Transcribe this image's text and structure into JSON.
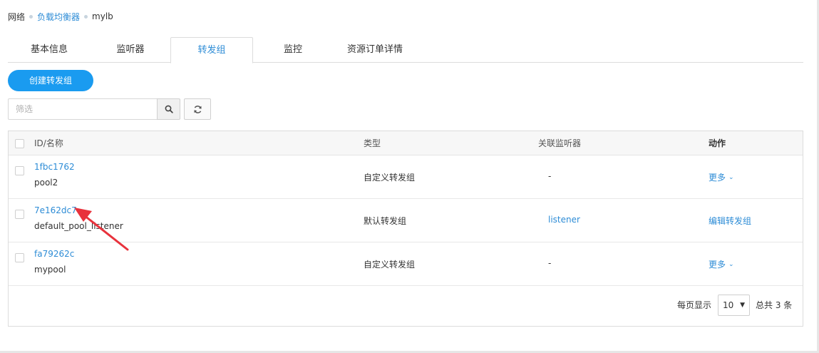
{
  "breadcrumb": {
    "items": [
      {
        "label": "网络"
      },
      {
        "label": "负载均衡器"
      },
      {
        "label": "mylb"
      }
    ]
  },
  "tabs": [
    {
      "label": "基本信息"
    },
    {
      "label": "监听器"
    },
    {
      "label": "转发组",
      "active": true
    },
    {
      "label": "监控"
    },
    {
      "label": "资源订单详情"
    }
  ],
  "toolbar": {
    "create_label": "创建转发组",
    "filter_placeholder": "筛选"
  },
  "table": {
    "columns": {
      "id_name": "ID/名称",
      "type": "类型",
      "listener": "关联监听器",
      "action": "动作"
    },
    "rows": [
      {
        "id": "1fbc1762",
        "name": "pool2",
        "type": "自定义转发组",
        "listener": "-",
        "action": "更多"
      },
      {
        "id": "7e162dc7",
        "name": "default_pool_listener",
        "type": "默认转发组",
        "listener": "listener",
        "action": "编辑转发组"
      },
      {
        "id": "fa79262c",
        "name": "mypool",
        "type": "自定义转发组",
        "listener": "-",
        "action": "更多"
      }
    ]
  },
  "pagination": {
    "per_page_label": "每页显示",
    "per_page_value": "10",
    "total_label": "总共 3 条"
  },
  "colors": {
    "accent": "#1a9bf0",
    "link": "#2d8cd6",
    "annotation_arrow": "#e8323c"
  }
}
